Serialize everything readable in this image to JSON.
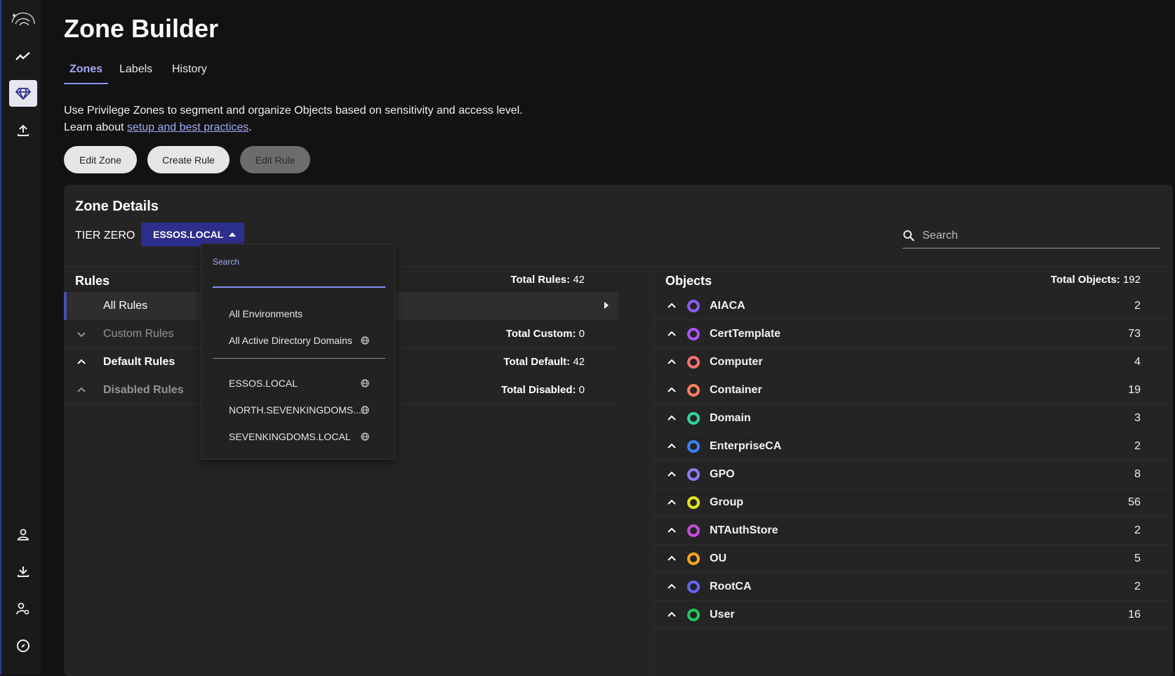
{
  "app": {
    "title": "Zone Builder"
  },
  "tabs": [
    {
      "label": "Zones"
    },
    {
      "label": "Labels"
    },
    {
      "label": "History"
    }
  ],
  "description": {
    "line1": "Use Privilege Zones to segment and organize Objects based on sensitivity and access level.",
    "line2_prefix": "Learn about ",
    "link": "setup and best practices",
    "line2_suffix": "."
  },
  "buttons": {
    "edit_zone": "Edit Zone",
    "create_rule": "Create Rule",
    "edit_rule": "Edit Rule"
  },
  "zone_details": {
    "title": "Zone Details",
    "tier": "TIER ZERO",
    "environment": "ESSOS.LOCAL",
    "search_placeholder": "Search"
  },
  "rules": {
    "title": "Rules",
    "total_label": "Total Rules:",
    "total": "42",
    "rows": [
      {
        "label": "All Rules",
        "total_label": "",
        "total": ""
      },
      {
        "label": "Custom Rules",
        "total_label": "Total Custom:",
        "total": "0"
      },
      {
        "label": "Default Rules",
        "total_label": "Total Default:",
        "total": "42"
      },
      {
        "label": "Disabled Rules",
        "total_label": "Total Disabled:",
        "total": "0"
      }
    ]
  },
  "objects": {
    "title": "Objects",
    "total_label": "Total Objects:",
    "total": "192",
    "rows": [
      {
        "name": "AIACA",
        "count": "2",
        "color": "#8b5cf6",
        "icon": "aiaca-icon"
      },
      {
        "name": "CertTemplate",
        "count": "73",
        "color": "#a855f7",
        "icon": "cert-template-icon"
      },
      {
        "name": "Computer",
        "count": "4",
        "color": "#f87171",
        "icon": "computer-icon"
      },
      {
        "name": "Container",
        "count": "19",
        "color": "#fb7d5b",
        "icon": "container-icon"
      },
      {
        "name": "Domain",
        "count": "3",
        "color": "#34d399",
        "icon": "domain-icon"
      },
      {
        "name": "EnterpriseCA",
        "count": "2",
        "color": "#3b82f6",
        "icon": "enterprise-ca-icon"
      },
      {
        "name": "GPO",
        "count": "8",
        "color": "#8b7cf6",
        "icon": "gpo-icon"
      },
      {
        "name": "Group",
        "count": "56",
        "color": "#e5e516",
        "icon": "group-icon"
      },
      {
        "name": "NTAuthStore",
        "count": "2",
        "color": "#c54ddb",
        "icon": "ntauthstore-icon"
      },
      {
        "name": "OU",
        "count": "5",
        "color": "#f5a623",
        "icon": "ou-icon"
      },
      {
        "name": "RootCA",
        "count": "2",
        "color": "#6366f1",
        "icon": "root-ca-icon"
      },
      {
        "name": "User",
        "count": "16",
        "color": "#22c55e",
        "icon": "user-icon"
      }
    ]
  },
  "dropdown": {
    "search_label": "Search",
    "top_items": [
      {
        "label": "All Environments"
      },
      {
        "label": "All Active Directory Domains"
      }
    ],
    "domain_items": [
      {
        "label": "ESSOS.LOCAL"
      },
      {
        "label": "NORTH.SEVENKINGDOMS...."
      },
      {
        "label": "SEVENKINGDOMS.LOCAL"
      }
    ]
  }
}
